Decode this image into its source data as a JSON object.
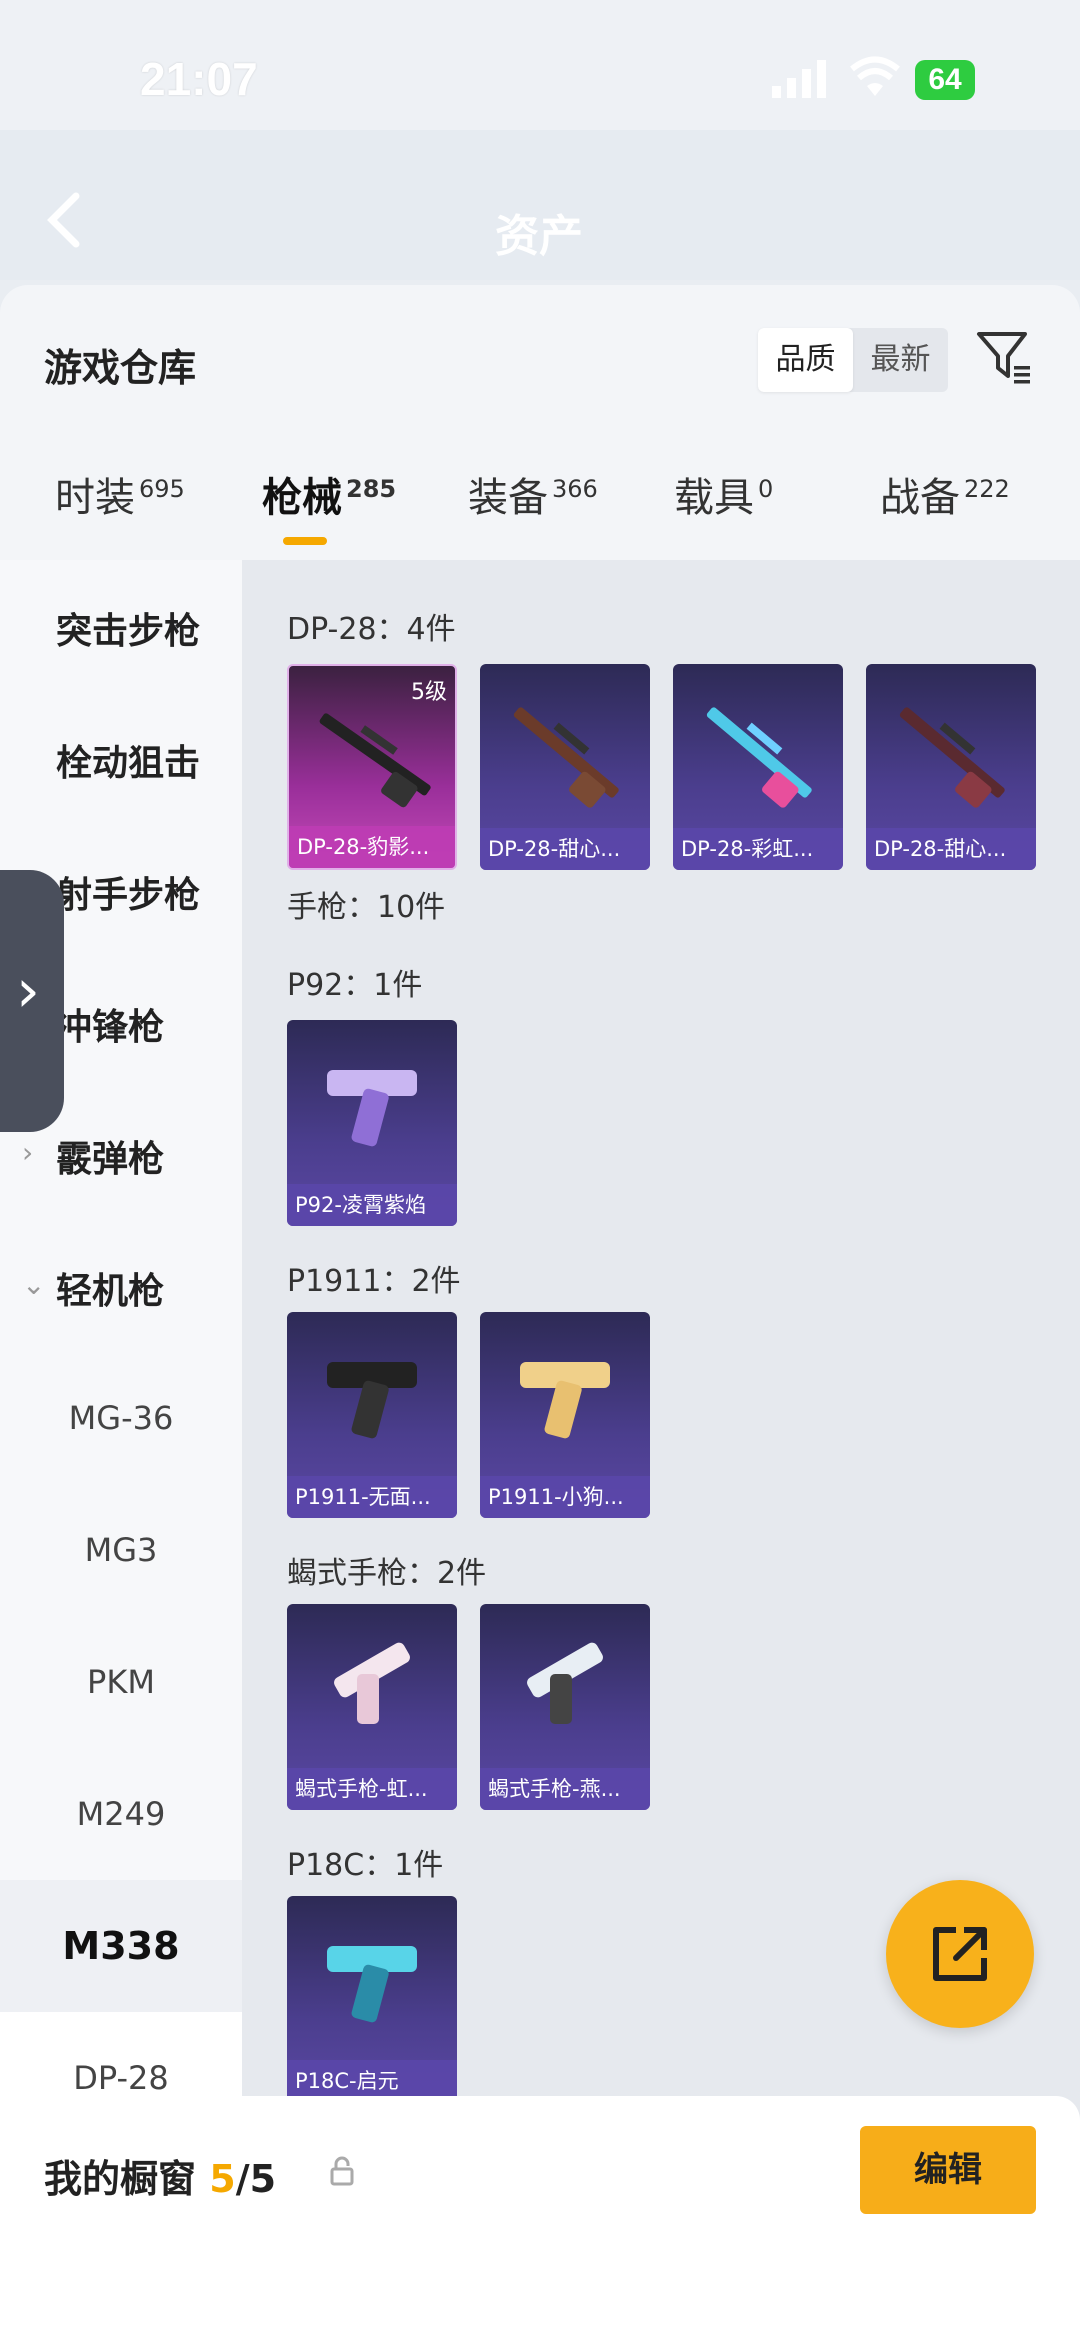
{
  "status_bar": {
    "time": "21:07",
    "battery": "64"
  },
  "nav": {
    "title": "资产"
  },
  "warehouse": {
    "title": "游戏仓库",
    "sort_options": [
      "品质",
      "最新"
    ],
    "active_sort": "品质"
  },
  "tabs": [
    {
      "label": "时装",
      "count": "695"
    },
    {
      "label": "枪械",
      "count": "285"
    },
    {
      "label": "装备",
      "count": "366"
    },
    {
      "label": "载具",
      "count": "0"
    },
    {
      "label": "战备",
      "count": "222"
    }
  ],
  "sidebar": {
    "categories": [
      {
        "label": "突击步枪"
      },
      {
        "label": "栓动狙击"
      },
      {
        "label": "射手步枪"
      },
      {
        "label": "冲锋枪"
      },
      {
        "label": "霰弹枪"
      },
      {
        "label": "轻机枪"
      }
    ],
    "subitems": [
      "MG-36",
      "MG3",
      "PKM",
      "M249",
      "M338",
      "DP-28"
    ],
    "active_subitem": "M338"
  },
  "content": {
    "sections": [
      {
        "label": "DP-28：4件"
      },
      {
        "label": "手枪：10件"
      },
      {
        "label": "P92：1件"
      },
      {
        "label": "P1911：2件"
      },
      {
        "label": "蝎式手枪：2件"
      },
      {
        "label": "P18C：1件"
      }
    ],
    "items": [
      {
        "label": "DP-28-豹影...",
        "level": "5级"
      },
      {
        "label": "DP-28-甜心..."
      },
      {
        "label": "DP-28-彩虹..."
      },
      {
        "label": "DP-28-甜心..."
      },
      {
        "label": "P92-凌霄紫焰"
      },
      {
        "label": "P1911-无面..."
      },
      {
        "label": "P1911-小狗..."
      },
      {
        "label": "蝎式手枪-虹..."
      },
      {
        "label": "蝎式手枪-燕..."
      },
      {
        "label": "P18C-启元"
      }
    ]
  },
  "bottom": {
    "label": "我的橱窗",
    "count": "5",
    "total": "/5",
    "edit_label": "编辑"
  },
  "colors": {
    "accent": "#f7ad19",
    "card": "#4b3e8e",
    "card_gold": "#c44ab8"
  }
}
